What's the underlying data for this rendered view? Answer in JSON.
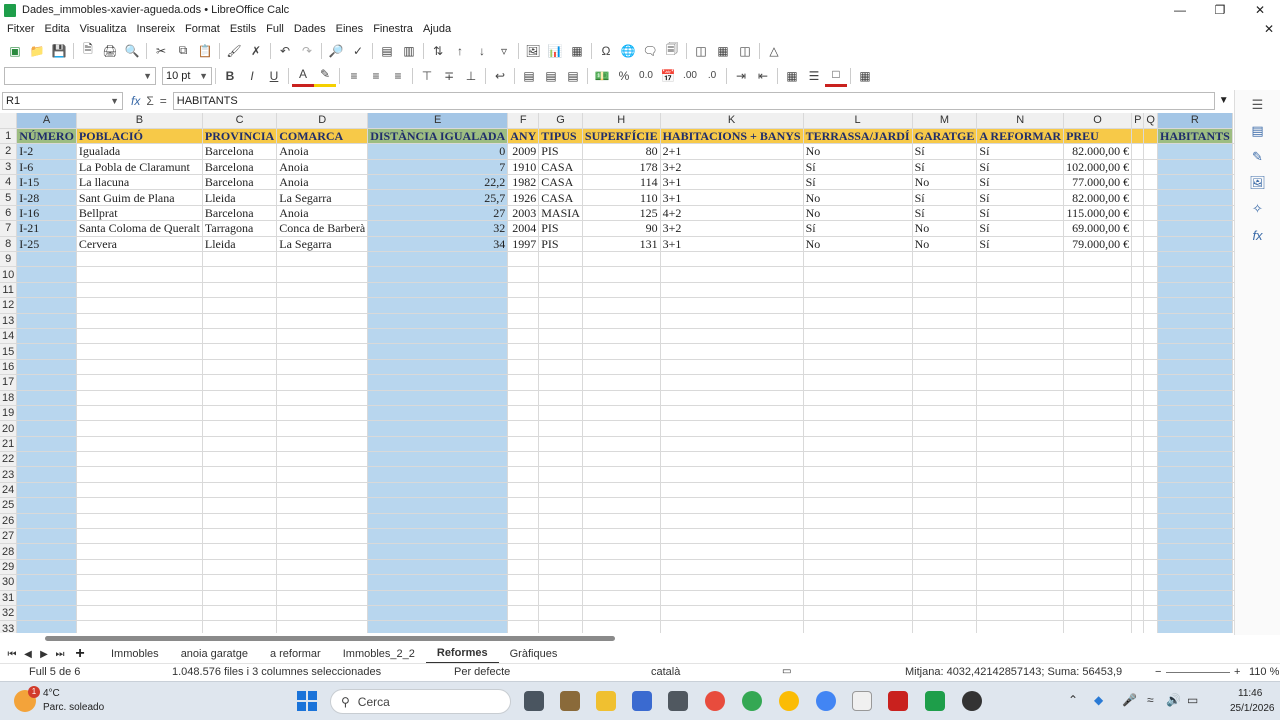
{
  "window": {
    "title": "Dades_immobles-xavier-agueda.ods • LibreOffice Calc"
  },
  "menu": [
    "Fitxer",
    "Edita",
    "Visualitza",
    "Insereix",
    "Format",
    "Estils",
    "Full",
    "Dades",
    "Eines",
    "Finestra",
    "Ajuda"
  ],
  "format_bar": {
    "font_name": "",
    "font_size": "10 pt"
  },
  "formula_bar": {
    "cell_ref": "R1",
    "content": "HABITANTS"
  },
  "grid": {
    "columns": [
      "A",
      "B",
      "C",
      "D",
      "E",
      "F",
      "G",
      "H",
      "K",
      "L",
      "M",
      "N",
      "O",
      "P",
      "Q",
      "R"
    ],
    "header_row": [
      "NÚMERO",
      "POBLACIÓ",
      "PROVINCIA",
      "COMARCA",
      "DISTÀNCIA IGUALADA",
      "ANY",
      "TIPUS",
      "SUPERFÍCIE",
      "HABITACIONS + BANYS",
      "TERRASSA/JARDÍ",
      "GARATGE",
      "A REFORMAR",
      "PREU",
      "",
      "",
      "HABITANTS"
    ],
    "rows": [
      [
        "I-2",
        "Igualada",
        "Barcelona",
        "Anoia",
        "0",
        "2009",
        "PIS",
        "80",
        "2+1",
        "No",
        "Sí",
        "Sí",
        "82.000,00 €",
        "",
        "",
        ""
      ],
      [
        "I-6",
        "La Pobla de Claramunt",
        "Barcelona",
        "Anoia",
        "7",
        "1910",
        "CASA",
        "178",
        "3+2",
        "Sí",
        "Sí",
        "Sí",
        "102.000,00 €",
        "",
        "",
        ""
      ],
      [
        "I-15",
        "La llacuna",
        "Barcelona",
        "Anoia",
        "22,2",
        "1982",
        "CASA",
        "114",
        "3+1",
        "Sí",
        "No",
        "Sí",
        "77.000,00 €",
        "",
        "",
        ""
      ],
      [
        "I-28",
        "Sant Guim de Plana",
        "Lleida",
        "La Segarra",
        "25,7",
        "1926",
        "CASA",
        "110",
        "3+1",
        "No",
        "Sí",
        "Sí",
        "82.000,00 €",
        "",
        "",
        ""
      ],
      [
        "I-16",
        "Bellprat",
        "Barcelona",
        "Anoia",
        "27",
        "2003",
        "MASIA",
        "125",
        "4+2",
        "No",
        "Sí",
        "Sí",
        "115.000,00 €",
        "",
        "",
        ""
      ],
      [
        "I-21",
        "Santa Coloma de Queralt",
        "Tarragona",
        "Conca de Barberà",
        "32",
        "2004",
        "PIS",
        "90",
        "3+2",
        "Sí",
        "No",
        "Sí",
        "69.000,00 €",
        "",
        "",
        ""
      ],
      [
        "I-25",
        "Cervera",
        "Lleida",
        "La Segarra",
        "34",
        "1997",
        "PIS",
        "131",
        "3+1",
        "No",
        "No",
        "Sí",
        "79.000,00 €",
        "",
        "",
        ""
      ]
    ],
    "row_numbers": [
      "1",
      "2",
      "3",
      "4",
      "5",
      "6",
      "7",
      "8",
      "9",
      "10",
      "11",
      "12",
      "13",
      "14",
      "15",
      "16",
      "17",
      "18",
      "19",
      "20",
      "21",
      "22",
      "23",
      "24",
      "25",
      "26",
      "27",
      "28",
      "29",
      "30",
      "31",
      "32",
      "33"
    ]
  },
  "sheets": [
    "Immobles",
    "anoia garatge",
    "a reformar",
    "Immobles_2_2",
    "Reformes",
    "Gràfiques"
  ],
  "active_sheet": "Reformes",
  "status": {
    "sheet_pos": "Full 5 de 6",
    "selection": "1.048.576 files i 3 columnes seleccionades",
    "style": "Per defecte",
    "language": "català",
    "summary": "Mitjana: 4032,42142857143; Suma: 56453,9",
    "zoom": "110 %"
  },
  "taskbar": {
    "weather_temp": "4°C",
    "weather_desc": "Parc. soleado",
    "weather_badge": "1",
    "search_placeholder": "Cerca",
    "time": "11:46",
    "date": "25/1/2026"
  },
  "colors": {
    "header_fill": "#f7c948",
    "selection": "#b8d6ee",
    "header_text": "#1f2d6b"
  }
}
